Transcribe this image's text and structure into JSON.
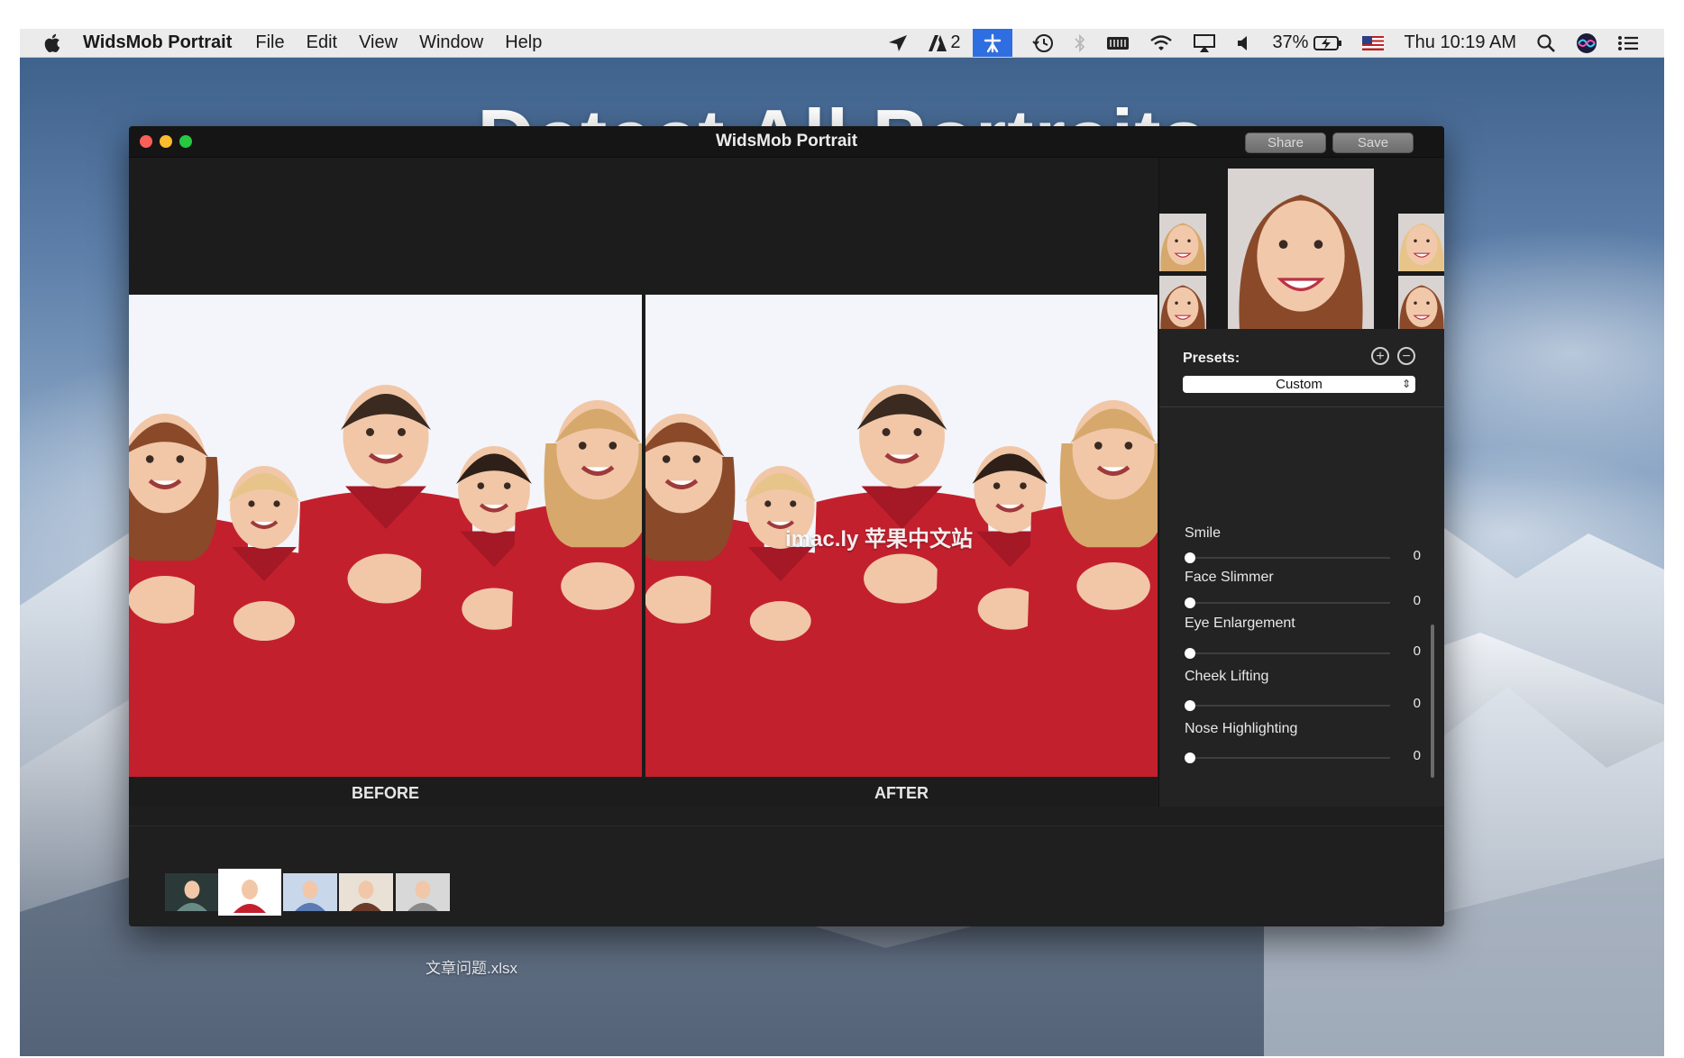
{
  "menubar": {
    "app_name": "WidsMob Portrait",
    "items": [
      "File",
      "Edit",
      "View",
      "Window",
      "Help"
    ],
    "notif_count": "2",
    "battery": "37%",
    "clock": "Thu 10:19 AM",
    "icons": [
      "apple-icon",
      "location-arrow-icon",
      "adobe-icon",
      "scissors-icon",
      "time-machine-icon",
      "bluetooth-icon",
      "battery-cell-icon",
      "wifi-icon",
      "airplay-icon",
      "volume-icon",
      "battery-charging-icon",
      "us-flag-icon",
      "spotlight-search-icon",
      "siri-icon",
      "notification-list-icon"
    ]
  },
  "headline": "Detect All Portraits",
  "window": {
    "title": "WidsMob Portrait",
    "share_label": "Share",
    "save_label": "Save",
    "before_label": "BEFORE",
    "after_label": "AFTER",
    "watermark": "imac.ly 苹果中文站"
  },
  "panel": {
    "presets_label": "Presets:",
    "preset_value": "Custom",
    "sliders": [
      {
        "label": "Smile",
        "value": "0",
        "fraction": 0
      },
      {
        "label": "Face Slimmer",
        "value": "0",
        "fraction": 0
      },
      {
        "label": "Eye Enlargement",
        "value": "0",
        "fraction": 0
      },
      {
        "label": "Cheek Lifting",
        "value": "0",
        "fraction": 0
      },
      {
        "label": "Nose Highlighting",
        "value": "0",
        "fraction": 0
      }
    ]
  },
  "thumbnails": [
    {
      "name": "portrait-thumb-1",
      "selected": false
    },
    {
      "name": "family-thumb",
      "selected": true
    },
    {
      "name": "group-thumb",
      "selected": false
    },
    {
      "name": "woman-hat-thumb",
      "selected": false
    },
    {
      "name": "elderly-thumb",
      "selected": false
    }
  ],
  "desktop_file": "文章问题.xlsx",
  "colors": {
    "accent": "#2f6ee0",
    "shirt_red": "#c3202e",
    "window_bg": "#1e1e1e"
  }
}
